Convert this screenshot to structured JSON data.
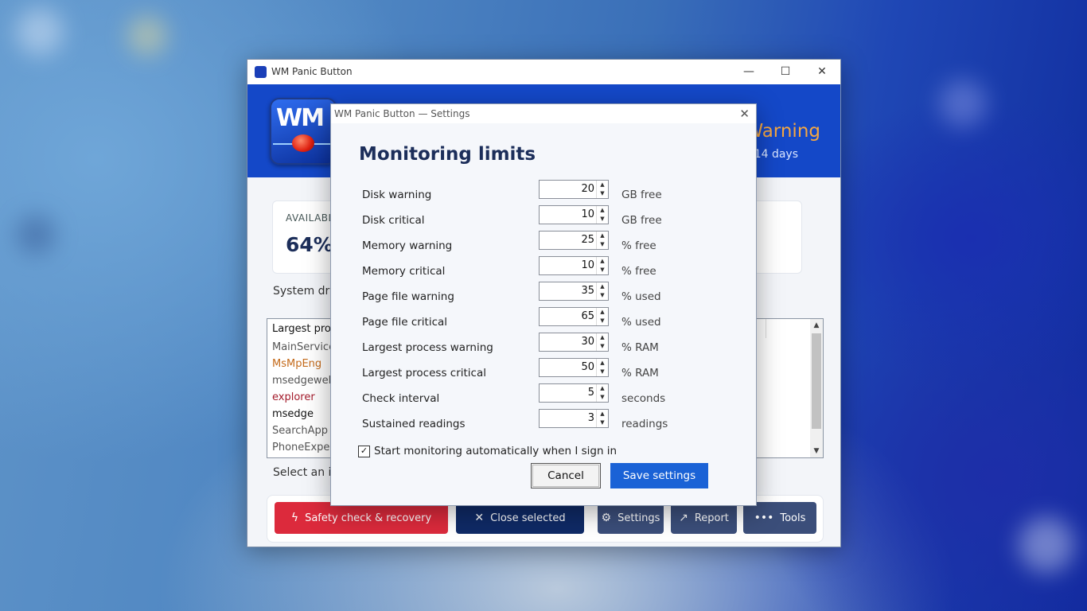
{
  "main_window": {
    "title": "WM Panic Button",
    "controls": {
      "minimize": "—",
      "maximize": "☐",
      "close": "✕"
    },
    "logo_text": "WM",
    "header_status": "Warning",
    "header_days": "14 days",
    "card_label": "AVAILABLE",
    "card_value": "64%",
    "system_drive_text": "System drive",
    "process_list": {
      "header": "Largest proc",
      "items": [
        {
          "name": "MainService",
          "color": "#555555"
        },
        {
          "name": "MsMpEng",
          "color": "#c46a1a"
        },
        {
          "name": "msedgewebv",
          "color": "#555555"
        },
        {
          "name": "explorer",
          "color": "#a31a2a"
        },
        {
          "name": "msedge",
          "color": "#111111"
        },
        {
          "name": "SearchApp",
          "color": "#555555"
        },
        {
          "name": "PhoneExperi",
          "color": "#555555"
        }
      ]
    },
    "select_hint": "Select an ite",
    "toolbar": {
      "safety_label": "Safety check & recovery",
      "close_selected_label": "Close selected",
      "settings_label": "Settings",
      "report_label": "Report",
      "tools_label": "Tools"
    }
  },
  "dialog": {
    "title": "WM Panic Button — Settings",
    "heading": "Monitoring limits",
    "rows": [
      {
        "label": "Disk warning",
        "value": "20",
        "unit": "GB free"
      },
      {
        "label": "Disk critical",
        "value": "10",
        "unit": "GB free"
      },
      {
        "label": "Memory warning",
        "value": "25",
        "unit": "% free"
      },
      {
        "label": "Memory critical",
        "value": "10",
        "unit": "% free"
      },
      {
        "label": "Page file warning",
        "value": "35",
        "unit": "% used"
      },
      {
        "label": "Page file critical",
        "value": "65",
        "unit": "% used"
      },
      {
        "label": "Largest process warning",
        "value": "30",
        "unit": "% RAM"
      },
      {
        "label": "Largest process critical",
        "value": "50",
        "unit": "% RAM"
      },
      {
        "label": "Check interval",
        "value": "5",
        "unit": "seconds"
      },
      {
        "label": "Sustained readings",
        "value": "3",
        "unit": "readings"
      }
    ],
    "auto_start_checked": true,
    "auto_start_label": "Start monitoring automatically when I sign in",
    "cancel_label": "Cancel",
    "save_label": "Save settings"
  },
  "colors": {
    "header_blue": "#1448c8",
    "accent_blue": "#1a62d6",
    "danger_red": "#dc2a3c",
    "navy": "#0f2a66",
    "slate": "#3b4e7a",
    "warning_orange": "#f5a742"
  }
}
